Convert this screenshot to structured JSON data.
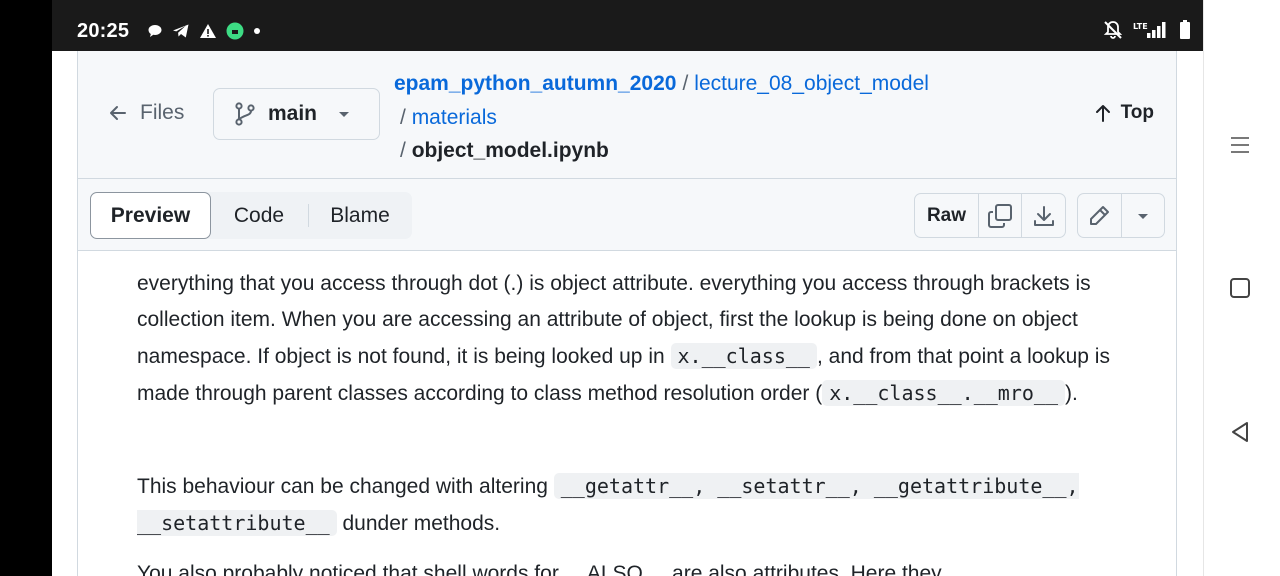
{
  "status_bar": {
    "time": "20:25"
  },
  "file_header": {
    "files_label": "Files",
    "branch": "main",
    "breadcrumb": {
      "repo": "epam_python_autumn_2020",
      "folder1": "lecture_08_object_model",
      "folder2": "materials",
      "file": "object_model.ipynb",
      "sep": "/"
    },
    "top_label": "Top"
  },
  "toolbar": {
    "tabs": [
      "Preview",
      "Code",
      "Blame"
    ],
    "raw_label": "Raw"
  },
  "content": {
    "p1": {
      "text1": "everything that you access through dot (.) is object attribute. everything you access through brackets is collection item. When you are accessing an attribute of object, first the lookup is being done on object namespace. If object is not found, it is being looked up in ",
      "code1": "x.__class__",
      "text2": ", and from that point a lookup is made through parent classes according to class method resolution order (",
      "code2": "x.__class__.__mro__",
      "text3": ")."
    },
    "p2": {
      "text1": "This behaviour can be changed with altering ",
      "code1": "__getattr__, __setattr__, __getattribute__, __setattribute__",
      "text2": " dunder methods."
    },
    "p3": {
      "text": "You also probably noticed that shell words for ... ALSO ... are also attributes. Here they..."
    }
  }
}
